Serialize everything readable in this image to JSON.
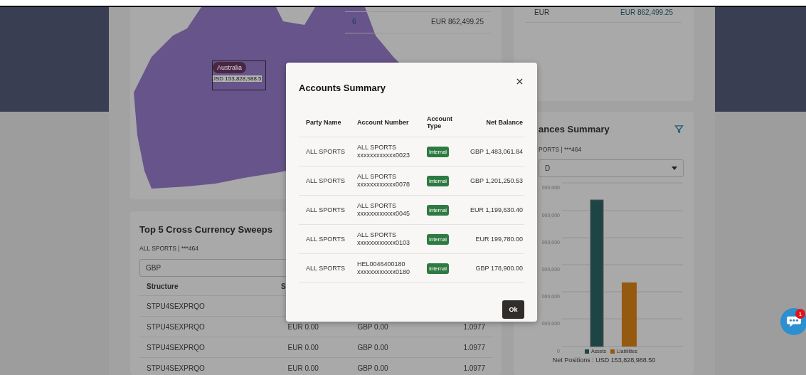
{
  "map": {
    "tooltip": {
      "region": "Australia",
      "value": "JSD 153,828,988.5"
    },
    "table_rows": [
      {
        "column_1": "6",
        "column_2": "EUR 862,499.25"
      }
    ]
  },
  "currency_card": {
    "rows": [
      {
        "currency": "EUR",
        "balance": "EUR 862,499.25"
      }
    ]
  },
  "sweeps": {
    "title": "Top 5 Cross Currency Sweeps",
    "account": "ALL SPORTS | ***464",
    "currency_select": {
      "value": "GBP"
    },
    "columns": [
      "Structure",
      "S"
    ],
    "rows": [
      {
        "cells": [
          "STPU4SEXPRQO"
        ]
      },
      {
        "cells": [
          "STPU4SEXPRQO",
          "EUR 0.00",
          "GBP 0.00",
          "1.0977"
        ]
      },
      {
        "cells": [
          "STPU4SEXPRQO",
          "EUR 0.00",
          "GBP 0.00",
          "1.0977"
        ]
      },
      {
        "cells": [
          "STPU4SEXPRQO",
          "EUR 0.00",
          "GBP 0.00",
          "1.0977"
        ]
      }
    ]
  },
  "balances": {
    "title": "ances Summary",
    "account": "PORTS | ***464",
    "currency_select": {
      "value": "D"
    },
    "chart": {
      "tick_labels": [
        "000,000",
        "000,000",
        "000,000",
        "000,000",
        "000,000",
        "000,000",
        "0"
      ],
      "legend": [
        {
          "label": "Assets",
          "color": "#1d4545"
        },
        {
          "label": "Liabilities",
          "color": "#95590f"
        }
      ],
      "net_positions": "Net Positions : USD 153,828,988.50"
    }
  },
  "modal": {
    "title": "Accounts Summary",
    "columns": [
      "Party Name",
      "Account Number",
      "Account Type",
      "Net Balance"
    ],
    "rows": [
      {
        "party": "ALL SPORTS",
        "account_name": "ALL SPORTS",
        "account_number": "xxxxxxxxxxxx0023",
        "type": "Internal",
        "balance": "GBP 1,483,061.84"
      },
      {
        "party": "ALL SPORTS",
        "account_name": "ALL SPORTS",
        "account_number": "xxxxxxxxxxxx0078",
        "type": "Internal",
        "balance": "GBP 1,201,250.53"
      },
      {
        "party": "ALL SPORTS",
        "account_name": "ALL SPORTS",
        "account_number": "xxxxxxxxxxxx0045",
        "type": "Internal",
        "balance": "EUR 1,199,630.40"
      },
      {
        "party": "ALL SPORTS",
        "account_name": "ALL SPORTS",
        "account_number": "xxxxxxxxxxxx0103",
        "type": "Internal",
        "balance": "EUR 199,780.00"
      },
      {
        "party": "ALL SPORTS",
        "account_name": "HEL0046400180",
        "account_number": "xxxxxxxxxxxx0180",
        "type": "Internal",
        "balance": "GBP 178,900.00"
      }
    ],
    "ok_button": "Ok"
  },
  "chat": {
    "badge": "1"
  }
}
